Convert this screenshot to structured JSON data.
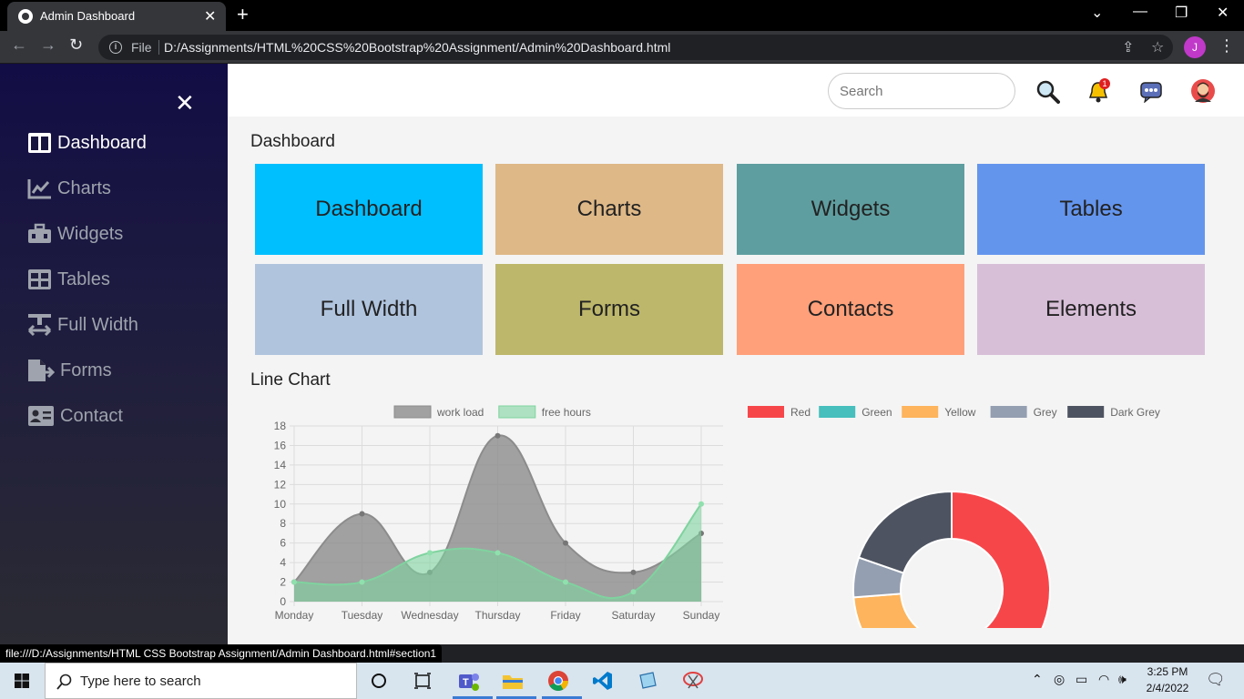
{
  "browser": {
    "tab_title": "Admin Dashboard",
    "file_label": "File",
    "url": "D:/Assignments/HTML%20CSS%20Bootstrap%20Assignment/Admin%20Dashboard.html",
    "profile_initial": "J"
  },
  "sidebar": {
    "items": [
      {
        "label": "Dashboard",
        "icon": "columns-icon"
      },
      {
        "label": "Charts",
        "icon": "line-chart-icon"
      },
      {
        "label": "Widgets",
        "icon": "toolbox-icon"
      },
      {
        "label": "Tables",
        "icon": "table-icon"
      },
      {
        "label": "Full Width",
        "icon": "full-width-icon"
      },
      {
        "label": "Forms",
        "icon": "file-export-icon"
      },
      {
        "label": "Contact",
        "icon": "contact-card-icon"
      }
    ]
  },
  "topbar": {
    "search_placeholder": "Search",
    "notification_count": "1"
  },
  "dashboard": {
    "title": "Dashboard",
    "cards": [
      {
        "label": "Dashboard",
        "color": "#00bfff"
      },
      {
        "label": "Charts",
        "color": "#deb887"
      },
      {
        "label": "Widgets",
        "color": "#5f9ea0"
      },
      {
        "label": "Tables",
        "color": "#6495ed"
      },
      {
        "label": "Full Width",
        "color": "#b0c4de"
      },
      {
        "label": "Forms",
        "color": "#bdb76b"
      },
      {
        "label": "Contacts",
        "color": "#ffa07a"
      },
      {
        "label": "Elements",
        "color": "#d8bfd8"
      }
    ]
  },
  "line_section": {
    "title": "Line Chart"
  },
  "chart_data": [
    {
      "type": "area",
      "title": "",
      "xlabel": "",
      "ylabel": "",
      "categories": [
        "Monday",
        "Tuesday",
        "Wednesday",
        "Thursday",
        "Friday",
        "Saturday",
        "Sunday"
      ],
      "ylim": [
        0,
        18
      ],
      "yticks": [
        0,
        2,
        4,
        6,
        8,
        10,
        12,
        14,
        16,
        18
      ],
      "grid": true,
      "legend": "top-center",
      "series": [
        {
          "name": "work load",
          "values": [
            2,
            9,
            3,
            17,
            6,
            3,
            7
          ],
          "color": "#8c8c8c"
        },
        {
          "name": "free hours",
          "values": [
            2,
            2,
            5,
            5,
            2,
            1,
            10
          ],
          "color": "#7fd39f"
        }
      ]
    },
    {
      "type": "pie",
      "title": "",
      "legend": "top",
      "donut": true,
      "labels": [
        "Red",
        "Green",
        "Yellow",
        "Grey",
        "Dark Grey"
      ],
      "values": [
        300,
        50,
        100,
        40,
        120
      ],
      "colors": [
        "#f7464a",
        "#46bfbd",
        "#fdb45c",
        "#949fb1",
        "#4d5360"
      ]
    }
  ],
  "status_url": "file:///D:/Assignments/HTML CSS Bootstrap Assignment/Admin Dashboard.html#section1",
  "taskbar": {
    "search_text": "Type here to search",
    "time": "3:25 PM",
    "date": "2/4/2022"
  }
}
